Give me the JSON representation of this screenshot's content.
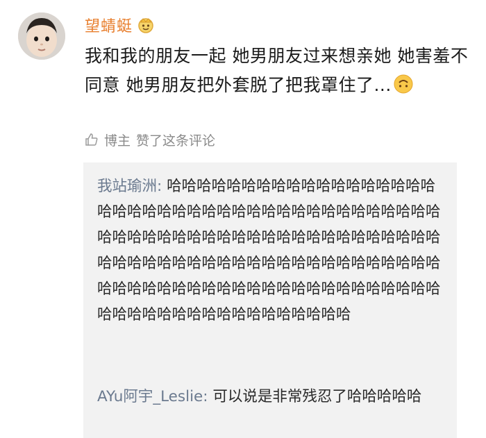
{
  "post": {
    "username": "望蜻蜓",
    "avatar_icon": "baby-avatar",
    "badge_icon": "vip-crown-icon",
    "content": "我和我的朋友一起 她男朋友过来想亲她 她害羞不同意 她男朋友把外套脱了把我罩住了...",
    "emoji_icon": "upside-down-face-emoji",
    "like_icon": "thumbs-up-icon",
    "like_author": "博主",
    "like_text": "赞了这条评论"
  },
  "replies": [
    {
      "author": "我站瑜洲: ",
      "text": "哈哈哈哈哈哈哈哈哈哈哈哈哈哈哈哈哈哈哈哈哈哈哈哈哈哈哈哈哈哈哈哈哈哈哈哈哈哈哈哈哈哈哈哈哈哈哈哈哈哈哈哈哈哈哈哈哈哈哈哈哈哈哈哈哈哈哈哈哈哈哈哈哈哈哈哈哈哈哈哈哈哈哈哈哈哈哈哈哈哈哈哈哈哈哈哈哈哈哈哈哈哈哈哈哈哈哈哈哈哈哈哈哈哈哈哈哈哈哈哈哈哈哈哈哈哈哈"
    },
    {
      "author": "AYu阿宇_Leslie: ",
      "text": "可以说是非常残忍了哈哈哈哈哈"
    }
  ],
  "colors": {
    "username": "#e87f2e",
    "reply_name": "#6b7a8f",
    "reply_bg": "#f2f2f2",
    "muted": "#8a8a8a"
  }
}
